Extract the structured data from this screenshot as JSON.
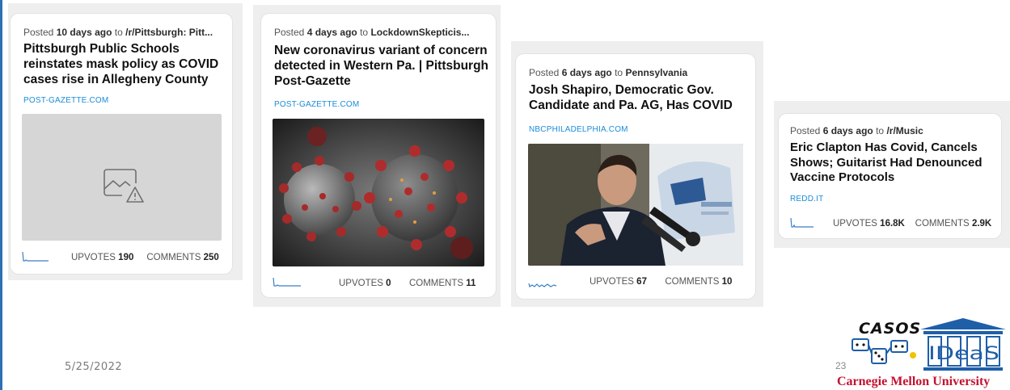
{
  "cards": [
    {
      "posted_prefix": "Posted",
      "age": "10 days ago",
      "to": "to",
      "community": "/r/Pittsburgh: Pitt...",
      "title": "Pittsburgh Public Schools reinstates mask policy as COVID cases rise in Allegheny County",
      "domain": "POST-GAZETTE.COM",
      "image": "broken-image-placeholder",
      "upvotes_label": "UPVOTES",
      "upvotes": "190",
      "comments_label": "COMMENTS",
      "comments": "250"
    },
    {
      "posted_prefix": "Posted",
      "age": "4 days ago",
      "to": "to",
      "community": "LockdownSkepticis...",
      "title": "New coronavirus variant of concern detected in Western Pa. | Pittsburgh Post-Gazette",
      "domain": "POST-GAZETTE.COM",
      "image": "coronavirus-illustration",
      "upvotes_label": "UPVOTES",
      "upvotes": "0",
      "comments_label": "COMMENTS",
      "comments": "11"
    },
    {
      "posted_prefix": "Posted",
      "age": "6 days ago",
      "to": "to",
      "community": "Pennsylvania",
      "title": "Josh Shapiro, Democratic Gov. Candidate and Pa. AG, Has COVID",
      "domain": "NBCPHILADELPHIA.COM",
      "image": "speaker-at-podium-photo",
      "upvotes_label": "UPVOTES",
      "upvotes": "67",
      "comments_label": "COMMENTS",
      "comments": "10"
    },
    {
      "posted_prefix": "Posted",
      "age": "6 days ago",
      "to": "to",
      "community": "/r/Music",
      "title": "Eric Clapton Has Covid, Cancels Shows; Guitarist Had Denounced Vaccine Protocols",
      "domain": "REDD.IT",
      "image": "",
      "upvotes_label": "UPVOTES",
      "upvotes": "16.8K",
      "comments_label": "COMMENTS",
      "comments": "2.9K"
    }
  ],
  "footer": {
    "date": "5/25/2022",
    "page_number": "23",
    "logo_casos": "CASOS",
    "logo_ideas": "IDeaS",
    "university": "Carnegie Mellon University"
  },
  "colors": {
    "accent_blue": "#1a8cd8",
    "spark_blue": "#3a7fc4",
    "cmu_red": "#c41230",
    "panel_gray": "#eeeeee"
  }
}
